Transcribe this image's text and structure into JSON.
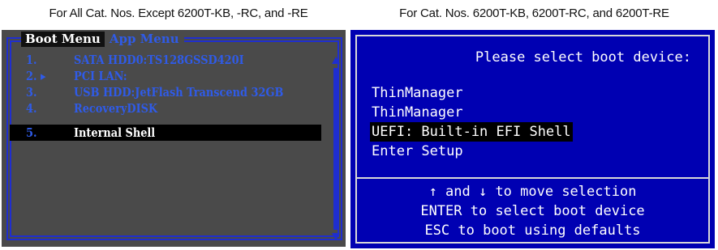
{
  "captions": {
    "left": "For All Cat. Nos. Except 6200T-KB, -RC, and -RE",
    "right": "For Cat. Nos. 6200T-KB, 6200T-RC, and 6200T-RE"
  },
  "left_menu": {
    "tabs": [
      "Boot Menu",
      "App Menu"
    ],
    "active_tab": "Boot Menu",
    "items": [
      {
        "num": "1.",
        "label": "SATA HDD0:TS128GSSD420I"
      },
      {
        "num": "2. ▸",
        "label": "PCI LAN:"
      },
      {
        "num": "3.",
        "label": "USB HDD:JetFlash Transcend 32GB"
      },
      {
        "num": "4.",
        "label": "RecoveryDISK"
      },
      {
        "num": "5.",
        "label": "Internal Shell"
      }
    ],
    "selected_index": 4,
    "colors": {
      "background": "#4a4a4a",
      "text": "#2f5be8",
      "frame": "#1f2ecf",
      "highlight": "#000000"
    }
  },
  "right_menu": {
    "title": "Please select boot device:",
    "items": [
      "ThinManager",
      "ThinManager",
      "UEFI: Built-in EFI Shell",
      "Enter Setup"
    ],
    "selected_index": 2,
    "help": [
      "↑ and ↓ to move selection",
      "ENTER to select boot device",
      "ESC to boot using defaults"
    ],
    "colors": {
      "background": "#0000b2",
      "text": "#ffffff",
      "frame": "#d8d8d8",
      "highlight": "#000000"
    }
  }
}
